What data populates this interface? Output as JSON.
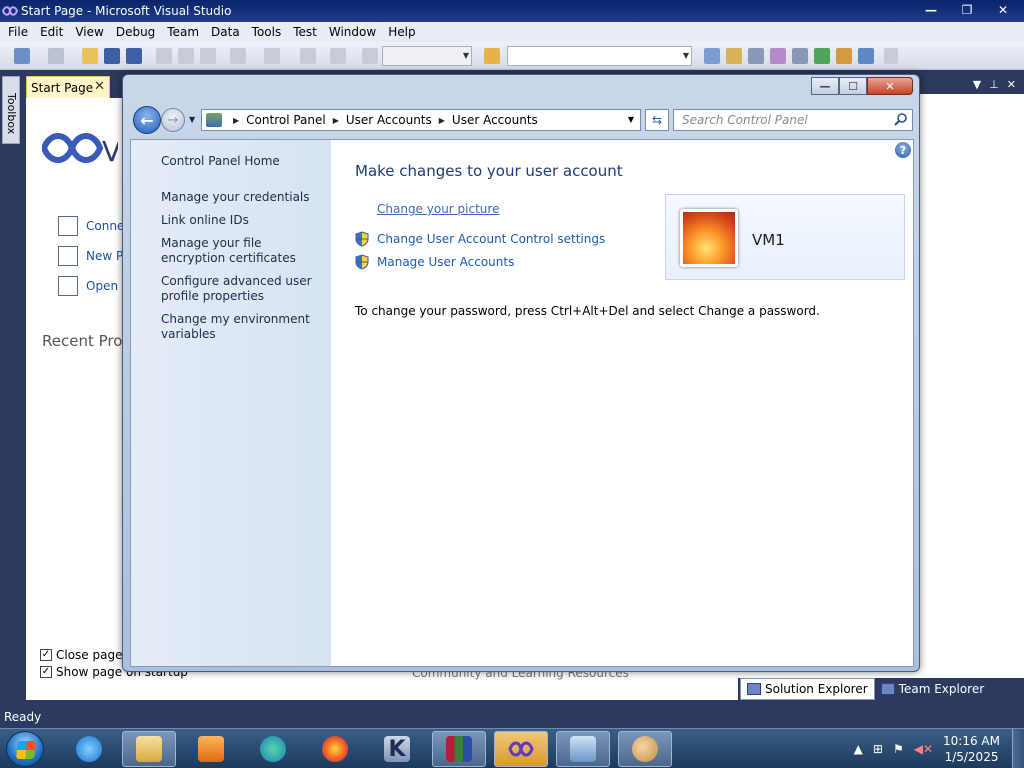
{
  "vs": {
    "title": "Start Page - Microsoft Visual Studio",
    "menu": [
      "File",
      "Edit",
      "View",
      "Debug",
      "Team",
      "Data",
      "Tools",
      "Test",
      "Window",
      "Help"
    ],
    "toolbox_label": "Toolbox",
    "doc_tab": "Start Page",
    "start_page": {
      "links": [
        "Conne",
        "New P",
        "Open"
      ],
      "recent_label": "Recent Proj",
      "close_check_label": "Close page a",
      "startup_check_label": "Show page on startup",
      "resources_faded": "Community and Learning Resources"
    },
    "bottom_tabs": [
      "Solution Explorer",
      "Team Explorer"
    ],
    "status": "Ready"
  },
  "control_panel": {
    "breadcrumb": [
      "Control Panel",
      "User Accounts",
      "User Accounts"
    ],
    "search_placeholder": "Search Control Panel",
    "left_links": [
      "Control Panel Home",
      "Manage your credentials",
      "Link online IDs",
      "Manage your file encryption certificates",
      "Configure advanced user profile properties",
      "Change my environment variables"
    ],
    "heading": "Make changes to your user account",
    "tasks": {
      "change_picture": "Change your picture",
      "uac": "Change User Account Control settings",
      "manage": "Manage User Accounts"
    },
    "user_name": "VM1",
    "password_note": "To change your password, press Ctrl+Alt+Del and select Change a password."
  },
  "taskbar": {
    "time": "10:16 AM",
    "date": "1/5/2025",
    "apps": [
      "internet-explorer",
      "file-explorer",
      "media-player",
      "edge",
      "firefox",
      "k-app",
      "winrar",
      "visual-studio",
      "remote-desktop",
      "user-accounts"
    ]
  }
}
